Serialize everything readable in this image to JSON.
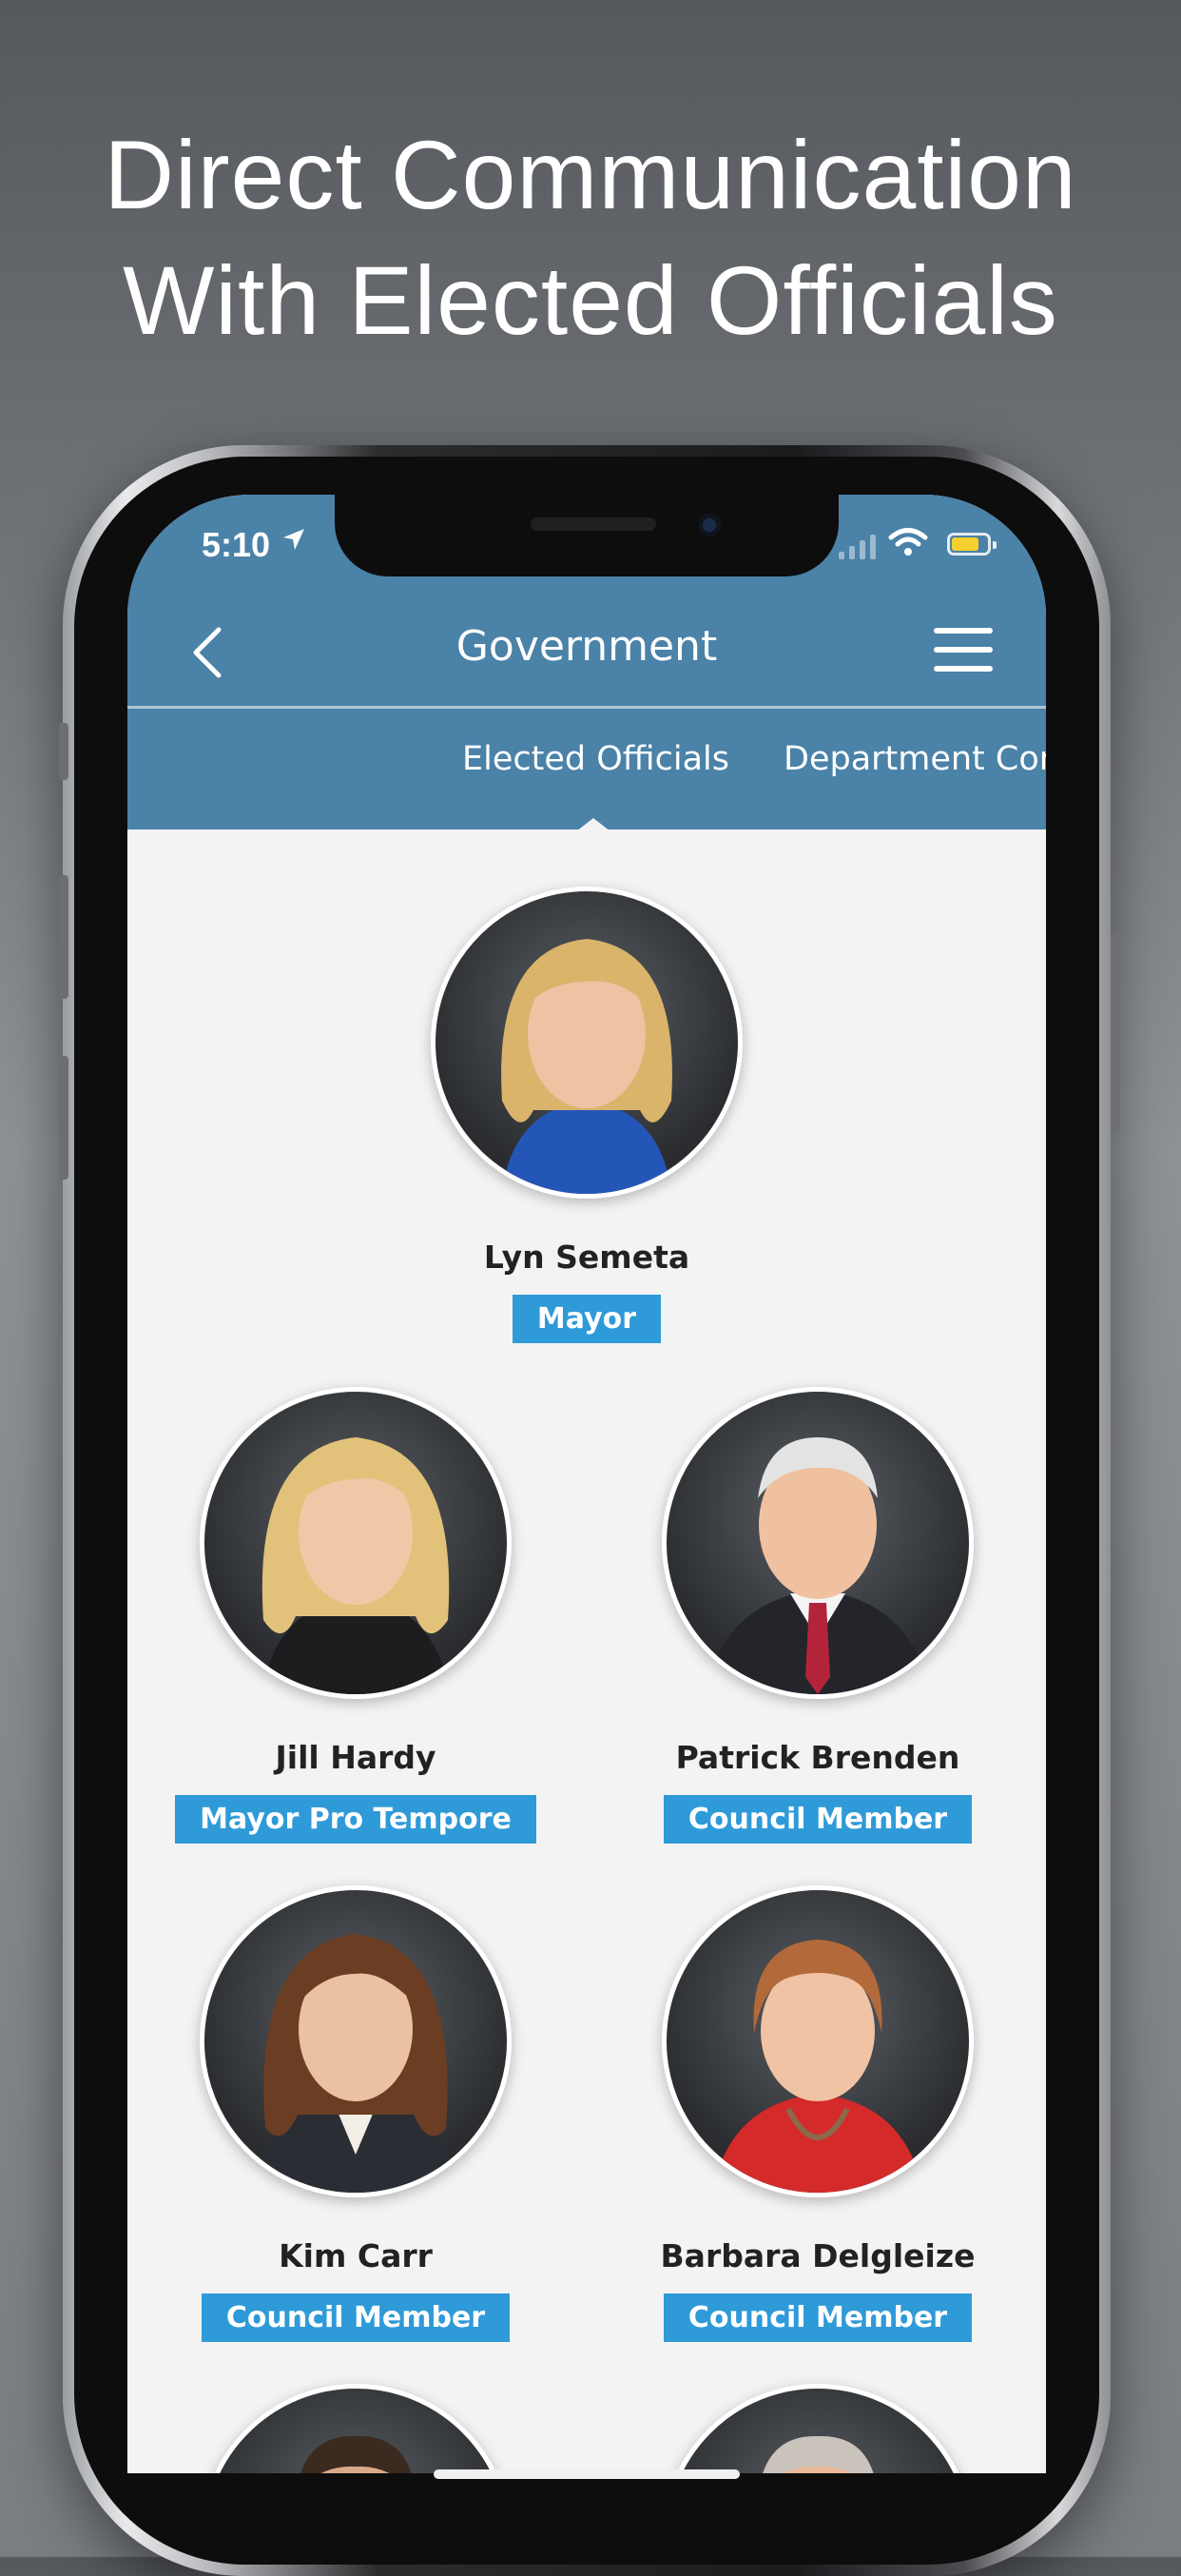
{
  "headline": {
    "line1": "Direct Communication",
    "line2": "With Elected Officials"
  },
  "status_bar": {
    "time": "5:10",
    "location_icon": "location-arrow-icon",
    "signal_icon": "cellular-signal-icon",
    "wifi_icon": "wifi-icon",
    "battery_icon": "battery-charging-icon",
    "battery_color": "#f5d02f"
  },
  "nav": {
    "back_icon": "chevron-left-icon",
    "title": "Government",
    "menu_icon": "hamburger-menu-icon",
    "bar_color": "#4a82a8"
  },
  "tabs": [
    {
      "label": "Elected Officials",
      "active": true
    },
    {
      "label": "Department Cor",
      "active": false
    }
  ],
  "officials": [
    {
      "name": "Lyn Semeta",
      "role": "Mayor"
    },
    {
      "name": "Jill Hardy",
      "role": "Mayor  Pro Tempore"
    },
    {
      "name": "Patrick Brenden",
      "role": "Council Member"
    },
    {
      "name": "Kim Carr",
      "role": "Council Member"
    },
    {
      "name": "Barbara Delgleize",
      "role": "Council Member"
    }
  ],
  "accent_colors": {
    "badge": "#2f9ad8",
    "screen_background": "#f4f3f4"
  }
}
